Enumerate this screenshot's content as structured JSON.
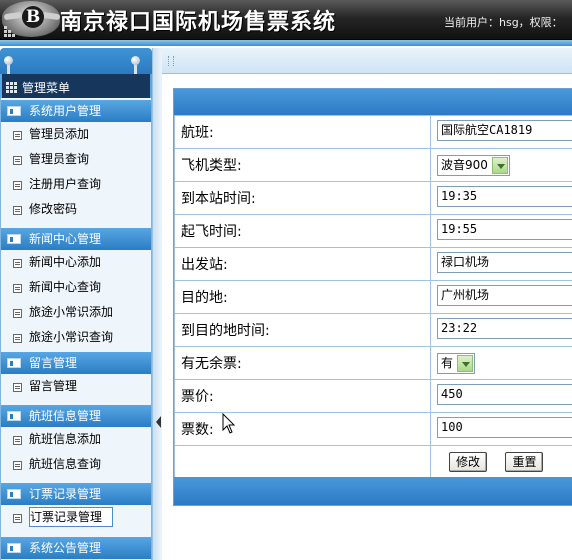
{
  "header": {
    "title": "南京禄口国际机场售票系统",
    "user_info": "当前用户：hsg，权限："
  },
  "menu": {
    "heading": "管理菜单",
    "groups": [
      {
        "title": "系统用户管理",
        "items": [
          "管理员添加",
          "管理员查询",
          "注册用户查询",
          "修改密码"
        ]
      },
      {
        "title": "新闻中心管理",
        "items": [
          "新闻中心添加",
          "新闻中心查询",
          "旅途小常识添加",
          "旅途小常识查询"
        ]
      },
      {
        "title": "留言管理",
        "items": [
          "留言管理"
        ]
      },
      {
        "title": "航班信息管理",
        "items": [
          "航班信息添加",
          "航班信息查询"
        ]
      },
      {
        "title": "订票记录管理",
        "items": [
          "订票记录管理"
        ]
      },
      {
        "title": "系统公告管理",
        "items": []
      }
    ],
    "active_item": "订票记录管理"
  },
  "form": {
    "fields": [
      {
        "label": "航班:",
        "value": "国际航空CA1819",
        "type": "text"
      },
      {
        "label": "飞机类型:",
        "value": "波音900",
        "type": "select"
      },
      {
        "label": "到本站时间:",
        "value": "19:35",
        "type": "text"
      },
      {
        "label": "起飞时间:",
        "value": "19:55",
        "type": "text"
      },
      {
        "label": "出发站:",
        "value": "禄口机场",
        "type": "text"
      },
      {
        "label": "目的地:",
        "value": "广州机场",
        "type": "text"
      },
      {
        "label": "到目的地时间:",
        "value": "23:22",
        "type": "text"
      },
      {
        "label": "有无余票:",
        "value": "有",
        "type": "select"
      },
      {
        "label": "票价:",
        "value": "450",
        "type": "text"
      },
      {
        "label": "票数:",
        "value": "100",
        "type": "text"
      }
    ],
    "buttons": {
      "modify": "修改",
      "reset": "重置"
    }
  },
  "colors": {
    "header_bg": "#1a1a1a",
    "accent_blue": "#2c7ac4",
    "sidebar_bg": "#eef5fb",
    "select_arrow": "#a9d98a"
  },
  "icons": {
    "logo": "bentley-b-badge-icon",
    "pin": "pushpin-icon",
    "menu_grid": "grid-icon",
    "group": "folder-icon",
    "item": "document-icon",
    "collapse": "collapse-arrow-icon",
    "dropdown": "chevron-down-icon"
  }
}
